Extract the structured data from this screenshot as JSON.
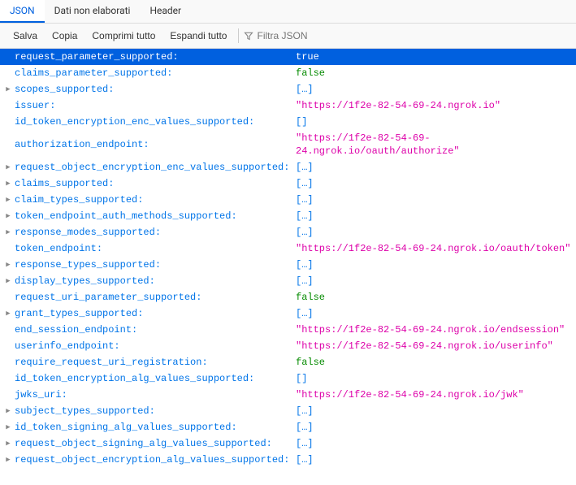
{
  "tabs": [
    {
      "label": "JSON",
      "active": true
    },
    {
      "label": "Dati non elaborati",
      "active": false
    },
    {
      "label": "Header",
      "active": false
    }
  ],
  "toolbar": {
    "save": "Salva",
    "copy": "Copia",
    "collapse": "Comprimi tutto",
    "expand": "Espandi tutto",
    "filter_placeholder": "Filtra JSON"
  },
  "rows": [
    {
      "key": "request_parameter_supported:",
      "value": "true",
      "vtype": "bool",
      "expandable": false,
      "selected": true
    },
    {
      "key": "claims_parameter_supported:",
      "value": "false",
      "vtype": "bool",
      "expandable": false
    },
    {
      "key": "scopes_supported:",
      "value": "[…]",
      "vtype": "array",
      "expandable": true
    },
    {
      "key": "issuer:",
      "value": "\"https://1f2e-82-54-69-24.ngrok.io\"",
      "vtype": "string",
      "expandable": false
    },
    {
      "key": "id_token_encryption_enc_values_supported:",
      "value": "[]",
      "vtype": "array",
      "expandable": false
    },
    {
      "key": "authorization_endpoint:",
      "value": "\"https://1f2e-82-54-69-24.ngrok.io/oauth/authorize\"",
      "vtype": "string",
      "expandable": false
    },
    {
      "key": "request_object_encryption_enc_values_supported:",
      "value": "[…]",
      "vtype": "array",
      "expandable": true
    },
    {
      "key": "claims_supported:",
      "value": "[…]",
      "vtype": "array",
      "expandable": true
    },
    {
      "key": "claim_types_supported:",
      "value": "[…]",
      "vtype": "array",
      "expandable": true
    },
    {
      "key": "token_endpoint_auth_methods_supported:",
      "value": "[…]",
      "vtype": "array",
      "expandable": true
    },
    {
      "key": "response_modes_supported:",
      "value": "[…]",
      "vtype": "array",
      "expandable": true
    },
    {
      "key": "token_endpoint:",
      "value": "\"https://1f2e-82-54-69-24.ngrok.io/oauth/token\"",
      "vtype": "string",
      "expandable": false
    },
    {
      "key": "response_types_supported:",
      "value": "[…]",
      "vtype": "array",
      "expandable": true
    },
    {
      "key": "display_types_supported:",
      "value": "[…]",
      "vtype": "array",
      "expandable": true
    },
    {
      "key": "request_uri_parameter_supported:",
      "value": "false",
      "vtype": "bool",
      "expandable": false
    },
    {
      "key": "grant_types_supported:",
      "value": "[…]",
      "vtype": "array",
      "expandable": true
    },
    {
      "key": "end_session_endpoint:",
      "value": "\"https://1f2e-82-54-69-24.ngrok.io/endsession\"",
      "vtype": "string",
      "expandable": false
    },
    {
      "key": "userinfo_endpoint:",
      "value": "\"https://1f2e-82-54-69-24.ngrok.io/userinfo\"",
      "vtype": "string",
      "expandable": false
    },
    {
      "key": "require_request_uri_registration:",
      "value": "false",
      "vtype": "bool",
      "expandable": false
    },
    {
      "key": "id_token_encryption_alg_values_supported:",
      "value": "[]",
      "vtype": "array",
      "expandable": false
    },
    {
      "key": "jwks_uri:",
      "value": "\"https://1f2e-82-54-69-24.ngrok.io/jwk\"",
      "vtype": "string",
      "expandable": false
    },
    {
      "key": "subject_types_supported:",
      "value": "[…]",
      "vtype": "array",
      "expandable": true
    },
    {
      "key": "id_token_signing_alg_values_supported:",
      "value": "[…]",
      "vtype": "array",
      "expandable": true
    },
    {
      "key": "request_object_signing_alg_values_supported:",
      "value": "[…]",
      "vtype": "array",
      "expandable": true
    },
    {
      "key": "request_object_encryption_alg_values_supported:",
      "value": "[…]",
      "vtype": "array",
      "expandable": true
    }
  ]
}
